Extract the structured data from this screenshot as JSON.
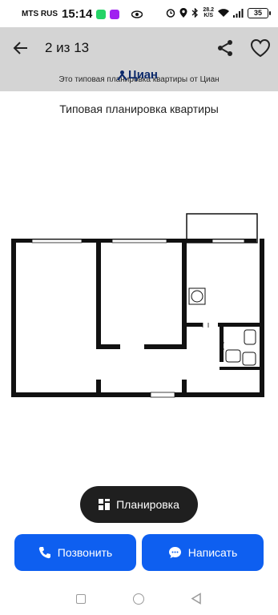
{
  "status_bar": {
    "carrier": "MTS RUS",
    "time": "15:14",
    "net_speed_value": "28.2",
    "net_speed_unit": "K/S",
    "battery": "35"
  },
  "header": {
    "counter": "2 из 13"
  },
  "caption": {
    "text": "Это типовая планировка квартиры от Циан",
    "logo_text": "Циан"
  },
  "plan": {
    "title": "Типовая планировка квартиры",
    "watermark": "Циан"
  },
  "plan_chip": {
    "label": "Планировка"
  },
  "actions": {
    "call_label": "Позвонить",
    "message_label": "Написать"
  },
  "colors": {
    "primary": "#0e5ff0",
    "header_bg": "#d4d4d4",
    "chip_bg": "#1f1f1f",
    "logo": "#0d2a6b"
  },
  "icons": [
    "back-arrow-icon",
    "share-icon",
    "heart-icon",
    "plan-grid-icon",
    "phone-icon",
    "chat-bubble-icon"
  ]
}
